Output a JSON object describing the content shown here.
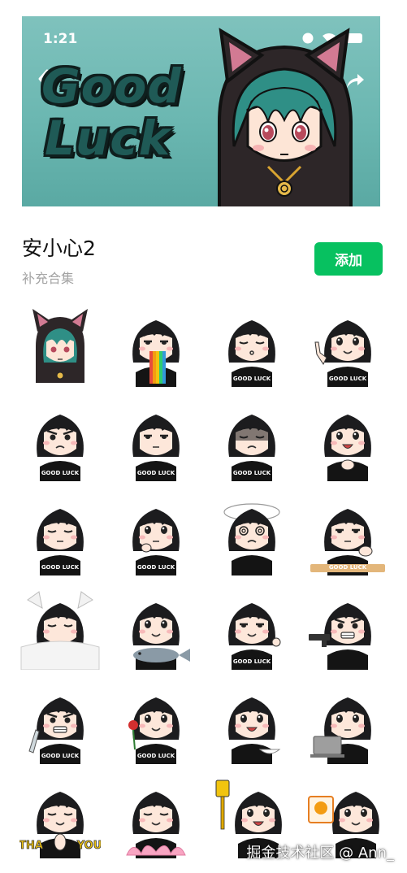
{
  "status_bar": {
    "time": "1:21"
  },
  "banner": {
    "text_line1": "Good",
    "text_line2": "Luck",
    "background_color": "#6bb7b1",
    "icons": [
      "back-icon",
      "share-icon",
      "signal-icon",
      "wifi-icon",
      "battery-icon"
    ]
  },
  "pack": {
    "title": "安小心2",
    "subtitle": "补充合集",
    "add_label": "添加",
    "accent_color": "#07c160"
  },
  "stickers": [
    {
      "name": "sticker-cat-hood-girl",
      "shirt": ""
    },
    {
      "name": "sticker-rainbow-vomit",
      "shirt": ""
    },
    {
      "name": "sticker-kiss",
      "shirt": "GOOD LUCK"
    },
    {
      "name": "sticker-pointing",
      "shirt": "GOOD LUCK"
    },
    {
      "name": "sticker-pout",
      "shirt": "GOOD LUCK"
    },
    {
      "name": "sticker-speechless",
      "shirt": "GOOD LUCK"
    },
    {
      "name": "sticker-gloomy",
      "shirt": "GOOD LUCK"
    },
    {
      "name": "sticker-excited-clap",
      "shirt": ""
    },
    {
      "name": "sticker-sigh",
      "shirt": "GOOD LUCK"
    },
    {
      "name": "sticker-thinking",
      "shirt": "GOOD LUCK"
    },
    {
      "name": "sticker-dizzy",
      "shirt": ""
    },
    {
      "name": "sticker-bored-desk",
      "shirt": "GOOD LUCK"
    },
    {
      "name": "sticker-sleeping",
      "shirt": ""
    },
    {
      "name": "sticker-holding-fish",
      "shirt": ""
    },
    {
      "name": "sticker-ok-gesture",
      "shirt": "GOOD LUCK"
    },
    {
      "name": "sticker-gun-angry",
      "shirt": ""
    },
    {
      "name": "sticker-knife-angry",
      "shirt": "GOOD LUCK"
    },
    {
      "name": "sticker-rose",
      "shirt": "GOOD LUCK"
    },
    {
      "name": "sticker-eating",
      "shirt": ""
    },
    {
      "name": "sticker-laptop",
      "shirt": ""
    },
    {
      "name": "sticker-thank-you",
      "shirt": ""
    },
    {
      "name": "sticker-lotus-pray",
      "shirt": ""
    },
    {
      "name": "sticker-spatula",
      "shirt": ""
    },
    {
      "name": "sticker-holding-sign",
      "shirt": ""
    }
  ],
  "sticker_caption": {
    "thank_you_left": "THA",
    "thank_you_right": "YOU"
  },
  "watermark": "掘金技术社区 @ Ann_"
}
